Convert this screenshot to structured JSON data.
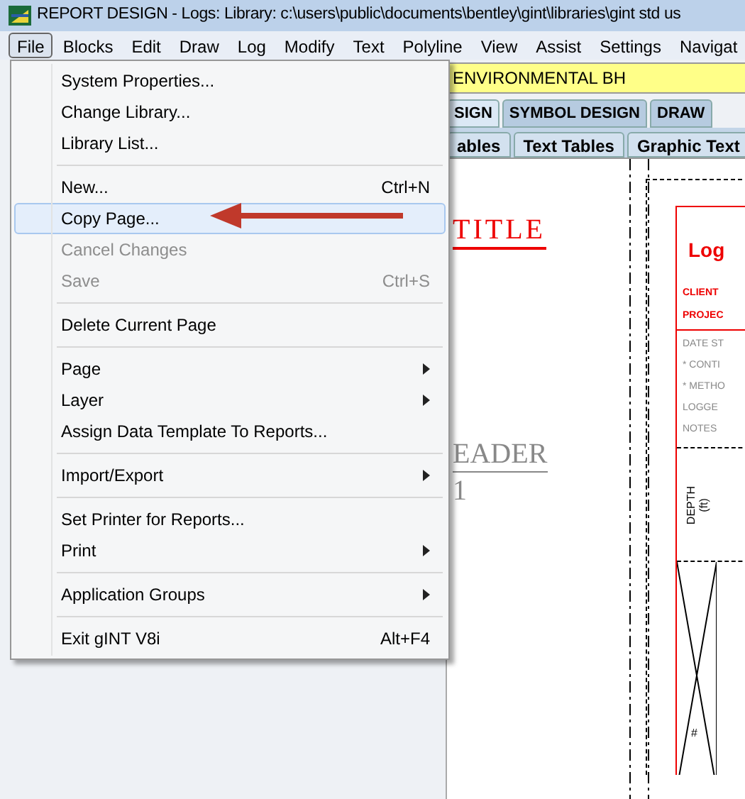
{
  "window": {
    "title": "REPORT DESIGN -  Logs:  Library: c:\\users\\public\\documents\\bentley\\gint\\libraries\\gint std us"
  },
  "menubar": [
    {
      "label": "File",
      "selected": true
    },
    {
      "label": "Blocks",
      "selected": false
    },
    {
      "label": "Edit",
      "selected": false
    },
    {
      "label": "Draw",
      "selected": false
    },
    {
      "label": "Log",
      "selected": false
    },
    {
      "label": "Modify",
      "selected": false
    },
    {
      "label": "Text",
      "selected": false
    },
    {
      "label": "Polyline",
      "selected": false
    },
    {
      "label": "View",
      "selected": false
    },
    {
      "label": "Assist",
      "selected": false
    },
    {
      "label": "Settings",
      "selected": false
    },
    {
      "label": "Navigat",
      "selected": false
    }
  ],
  "report_name_field": {
    "value": "ENVIRONMENTAL BH"
  },
  "tabs": [
    {
      "label": "SIGN",
      "selected": true
    },
    {
      "label": "SYMBOL DESIGN",
      "selected": false
    },
    {
      "label": "DRAW",
      "selected": false
    }
  ],
  "subtabs": [
    {
      "label": "ables",
      "selected": false
    },
    {
      "label": "Text Tables",
      "selected": false
    },
    {
      "label": "Graphic Text",
      "selected": false
    }
  ],
  "file_menu": [
    {
      "kind": "item",
      "label": "System Properties...",
      "disabled": false,
      "selected": false,
      "submenu": false
    },
    {
      "kind": "item",
      "label": "Change Library...",
      "disabled": false,
      "selected": false,
      "submenu": false
    },
    {
      "kind": "item",
      "label": "Library List...",
      "disabled": false,
      "selected": false,
      "submenu": false
    },
    {
      "kind": "separator"
    },
    {
      "kind": "item",
      "label": "New...",
      "shortcut": "Ctrl+N",
      "disabled": false,
      "selected": false,
      "submenu": false
    },
    {
      "kind": "item",
      "label": "Copy Page...",
      "disabled": false,
      "selected": true,
      "submenu": false
    },
    {
      "kind": "item",
      "label": "Cancel Changes",
      "disabled": true,
      "selected": false,
      "submenu": false
    },
    {
      "kind": "item",
      "label": "Save",
      "shortcut": "Ctrl+S",
      "disabled": true,
      "selected": false,
      "submenu": false
    },
    {
      "kind": "separator"
    },
    {
      "kind": "item",
      "label": "Delete Current Page",
      "disabled": false,
      "selected": false,
      "submenu": false
    },
    {
      "kind": "separator"
    },
    {
      "kind": "item",
      "label": "Page",
      "disabled": false,
      "selected": false,
      "submenu": true
    },
    {
      "kind": "item",
      "label": "Layer",
      "disabled": false,
      "selected": false,
      "submenu": true
    },
    {
      "kind": "item",
      "label": "Assign Data Template To Reports...",
      "disabled": false,
      "selected": false,
      "submenu": false
    },
    {
      "kind": "separator"
    },
    {
      "kind": "item",
      "label": "Import/Export",
      "disabled": false,
      "selected": false,
      "submenu": true
    },
    {
      "kind": "separator"
    },
    {
      "kind": "item",
      "label": "Set Printer for Reports...",
      "disabled": false,
      "selected": false,
      "submenu": false
    },
    {
      "kind": "item",
      "label": "Print",
      "disabled": false,
      "selected": false,
      "submenu": true
    },
    {
      "kind": "separator"
    },
    {
      "kind": "item",
      "label": "Application Groups",
      "disabled": false,
      "selected": false,
      "submenu": true
    },
    {
      "kind": "separator"
    },
    {
      "kind": "item",
      "label": "Exit gINT V8i",
      "shortcut": "Alt+F4",
      "disabled": false,
      "selected": false,
      "submenu": false
    }
  ],
  "canvas": {
    "title_text": "TITLE",
    "header_text": "EADER",
    "header_number": "1",
    "log_form": {
      "heading": "Log",
      "red_fields": [
        "CLIENT",
        "PROJEC"
      ],
      "fields": [
        "DATE ST",
        "* CONTI",
        "* METHO",
        "LOGGE",
        "NOTES"
      ],
      "depth_label": "DEPTH",
      "depth_unit": "(ft)",
      "marker": "#"
    }
  }
}
